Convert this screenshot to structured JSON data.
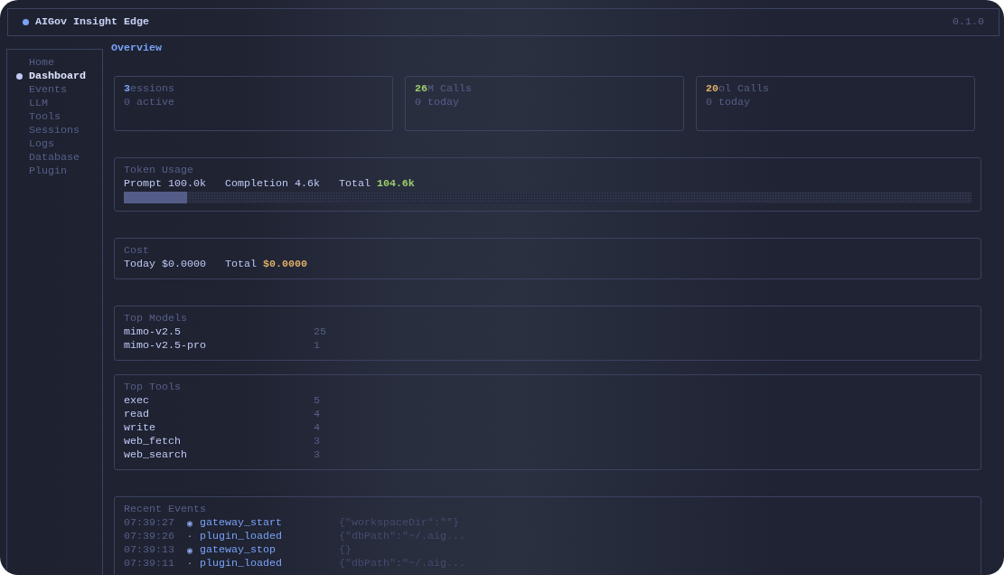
{
  "header": {
    "title": "AIGov Insight Edge",
    "version": "0.1.0"
  },
  "sidebar": {
    "items": [
      {
        "label": "Home",
        "selected": false
      },
      {
        "label": "Dashboard",
        "selected": true
      },
      {
        "label": "Events",
        "selected": false
      },
      {
        "label": "LLM",
        "selected": false
      },
      {
        "label": "Tools",
        "selected": false
      },
      {
        "label": "Sessions",
        "selected": false
      },
      {
        "label": "Logs",
        "selected": false
      },
      {
        "label": "Database",
        "selected": false
      },
      {
        "label": "Plugin",
        "selected": false
      }
    ]
  },
  "page_title": "Overview",
  "stat_cards": [
    {
      "value": "3",
      "label": "essions",
      "sub": "0 active",
      "color": "#7aa2f7"
    },
    {
      "value": "26",
      "label": "M Calls",
      "sub": "0 today",
      "color": "#9ece6a"
    },
    {
      "value": "20",
      "label": "ol Calls",
      "sub": "0 today",
      "color": "#e0af68"
    }
  ],
  "token_usage": {
    "title": "Token Usage",
    "items": [
      {
        "label": "Prompt",
        "value": "100.0k",
        "kind": "part"
      },
      {
        "label": "Completion",
        "value": "4.6k",
        "kind": "part"
      },
      {
        "label": "Total",
        "value": "104.6k",
        "kind": "total",
        "color": "#9ece6a"
      }
    ],
    "level": 0.075
  },
  "cost": {
    "title": "Cost",
    "items": [
      {
        "label": "Today",
        "value": "$0.0000",
        "kind": "part"
      },
      {
        "label": "Total",
        "value": "$0.0000",
        "kind": "total",
        "color": "#e0af68"
      }
    ]
  },
  "top_models": {
    "title": "Top Models",
    "rows": [
      {
        "name": "mimo-v2.5",
        "count": "25"
      },
      {
        "name": "mimo-v2.5-pro",
        "count": "1"
      }
    ]
  },
  "top_tools": {
    "title": "Top Tools",
    "rows": [
      {
        "name": "exec",
        "count": "5"
      },
      {
        "name": "read",
        "count": "4"
      },
      {
        "name": "write",
        "count": "4"
      },
      {
        "name": "web_fetch",
        "count": "3"
      },
      {
        "name": "web_search",
        "count": "3"
      }
    ]
  },
  "recent_events": {
    "title": "Recent Events",
    "rows": [
      {
        "time": "07:39:27",
        "marker": "◉",
        "event": "gateway_start",
        "payload": "{\"workspaceDir\":\"\"}"
      },
      {
        "time": "07:39:26",
        "marker": "·",
        "event": "plugin_loaded",
        "payload": "{\"dbPath\":\"~/.aig..."
      },
      {
        "time": "07:39:13",
        "marker": "◉",
        "event": "gateway_stop",
        "payload": "{}"
      },
      {
        "time": "07:39:11",
        "marker": "·",
        "event": "plugin_loaded",
        "payload": "{\"dbPath\":\"~/.aig..."
      }
    ]
  }
}
